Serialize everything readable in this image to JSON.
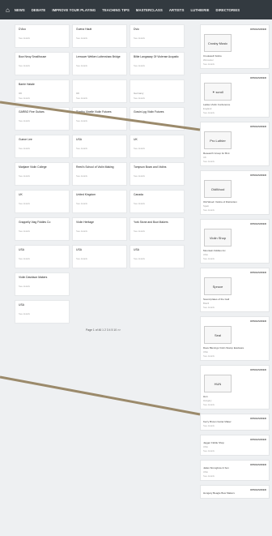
{
  "nav": {
    "home_icon": "home-icon",
    "items": [
      "NEWS",
      "DEBATE",
      "IMPROVE YOUR PLAYING",
      "TEACHING TIPS",
      "MASTERCLASS",
      "ARTISTS",
      "LUTHIERIE",
      "DIRECTORIES"
    ]
  },
  "cards": [
    {
      "title": "D'Avo",
      "meta": "",
      "sub": "See details"
    },
    {
      "title": "Guena Hautt",
      "meta": "",
      "sub": "See details"
    },
    {
      "title": "Dvio",
      "meta": "",
      "sub": "See details"
    },
    {
      "title": "Bow Neuy Smallhouse",
      "meta": "",
      "sub": "See details"
    },
    {
      "title": "Lemuuer Welken Luttenshaw Bridge",
      "meta": "",
      "sub": "See details"
    },
    {
      "title": "Biltie Langaway Of Violense Acqustic",
      "meta": "",
      "sub": "See details"
    },
    {
      "title": "Barrie Hatale",
      "meta": "UK",
      "sub": "See details"
    },
    {
      "title": "",
      "meta": "UK",
      "sub": "See details"
    },
    {
      "title": "",
      "meta": "Germany",
      "sub": "See details"
    },
    {
      "title": "GARBO Fine Guitars",
      "meta": "",
      "sub": "See details"
    },
    {
      "title": "Riarthu Vinelle Violin Futures",
      "meta": "",
      "sub": "See details"
    },
    {
      "title": "Gowin Lyg Violin Futures",
      "meta": "",
      "sub": "See details"
    },
    {
      "title": "Gueoe Lee",
      "meta": "",
      "sub": "See details"
    },
    {
      "title": "USA",
      "meta": "",
      "sub": "See details"
    },
    {
      "title": "UK",
      "meta": "",
      "sub": "See details"
    },
    {
      "title": "Marijane Violin College",
      "meta": "",
      "sub": "See details"
    },
    {
      "title": "Reed's School of Violin Making",
      "meta": "",
      "sub": "See details"
    },
    {
      "title": "Tompson Bows and Violins",
      "meta": "",
      "sub": "See details"
    },
    {
      "title": "UK",
      "meta": "",
      "sub": "See details"
    },
    {
      "title": "United Kingdom",
      "meta": "",
      "sub": "See details"
    },
    {
      "title": "Canada",
      "meta": "",
      "sub": "See details"
    },
    {
      "title": "Grappelly Viag Fiddles Co",
      "meta": "",
      "sub": "See details"
    },
    {
      "title": "Violin Heritage",
      "meta": "",
      "sub": "See details"
    },
    {
      "title": "York Stone and Bow Makers",
      "meta": "",
      "sub": "See details"
    },
    {
      "title": "USA",
      "meta": "",
      "sub": "See details"
    },
    {
      "title": "USA",
      "meta": "",
      "sub": "See details"
    },
    {
      "title": "USA",
      "meta": "",
      "sub": "See details"
    },
    {
      "title": "Violin Davidson Makers",
      "meta": "",
      "sub": "See details"
    },
    {
      "title": "",
      "meta": "",
      "sub": ""
    },
    {
      "title": "",
      "meta": "",
      "sub": ""
    },
    {
      "title": "USA",
      "meta": "",
      "sub": "See details"
    }
  ],
  "pager": "Page 1 of 46   1  2  3  4  5  10  >>",
  "sidebar": [
    {
      "date": "OPEN/ADDED",
      "thumb": "Crosby\nMusic",
      "cap": "Crookwell Violins",
      "loc": "Worcester",
      "more": "See details"
    },
    {
      "date": "OPEN/ADDED",
      "thumb": "✶ scroll",
      "cap": "Ladies Violin Conference",
      "loc": "England",
      "more": "See details"
    },
    {
      "date": "OPEN/ADDED",
      "thumb": "Pro Luthier",
      "cap": "Research Group for Bmt",
      "loc": "UK",
      "more": "See details"
    },
    {
      "date": "OPEN/ADDED",
      "thumb": "OldWood",
      "cap": "Old Wood: Violins of Distinction",
      "loc": "Spain",
      "more": "See details"
    },
    {
      "date": "OPEN/ADDED",
      "thumb": "Violin Shop",
      "cap": "Mountain Fiddles Inc",
      "loc": "USA",
      "more": "See details"
    },
    {
      "date": "OPEN/ADDED",
      "thumb": "Spruce",
      "cap": "Sound plates of the Gall",
      "loc": "Brazil",
      "more": "See details"
    },
    {
      "date": "OPEN/ADDED",
      "thumb": "Seal",
      "cap": "Dave Blenings Violin Stamp Eastware",
      "loc": "USA",
      "more": "See details"
    },
    {
      "date": "OPEN/ADDED",
      "thumb": "HUN",
      "cap": "Hun",
      "loc": "Hungary",
      "more": "See details"
    },
    {
      "date": "OPEN/ADDED",
      "thumb": "",
      "cap": "Kerry Brown Guitar Maker",
      "loc": "",
      "more": "See details"
    },
    {
      "date": "OPEN/ADDED",
      "thumb": "",
      "cap": "Jagger Fiddle Shop",
      "loc": "USA",
      "more": "See details"
    },
    {
      "date": "OPEN/ADDED",
      "thumb": "",
      "cap": "Jailes Strongbow & Son",
      "loc": "USA",
      "more": "See details"
    },
    {
      "date": "OPEN/ADDED",
      "thumb": "",
      "cap": "Hungary Beagle Bow Makers",
      "loc": "",
      "more": ""
    }
  ],
  "colors": {
    "nav_bg": "#333a40",
    "page_bg": "#eef0f2",
    "arrow": "#9b8a6b"
  }
}
